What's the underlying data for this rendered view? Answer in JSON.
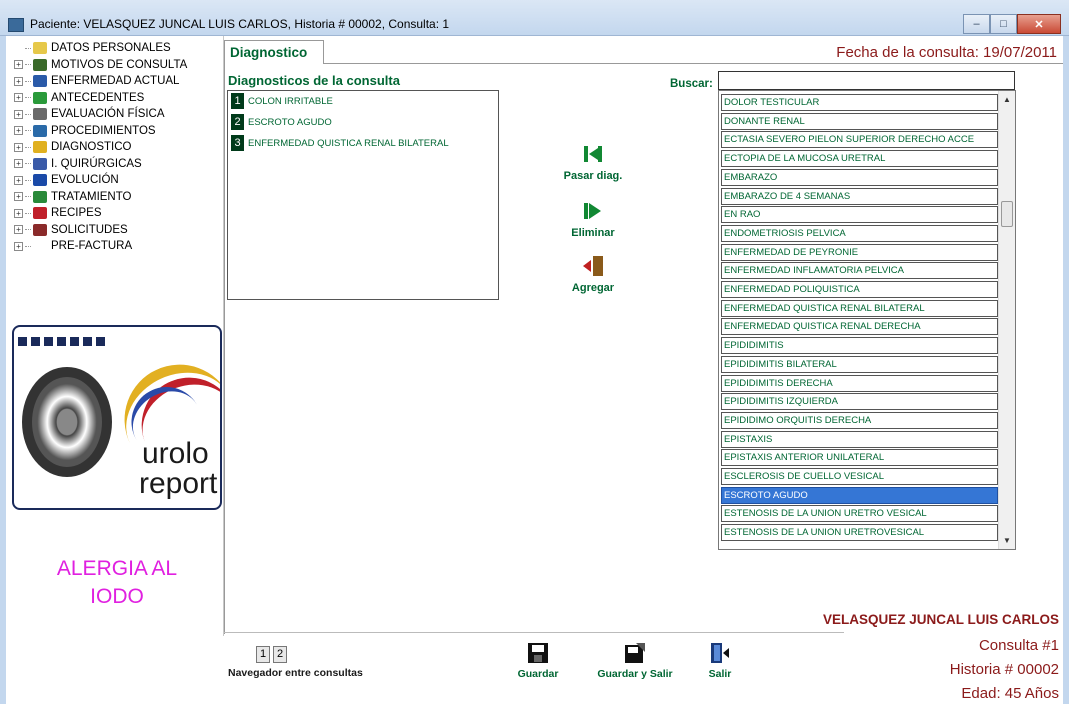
{
  "window": {
    "title": "Paciente: VELASQUEZ JUNCAL LUIS CARLOS, Historia # 00002, Consulta: 1",
    "controls": {
      "minimize": "–",
      "maximize": "□",
      "close": "✕"
    }
  },
  "tree": [
    {
      "label": "DATOS PERSONALES",
      "icon": "folder-open-icon",
      "color": "#e6c84a",
      "expandable": false
    },
    {
      "label": "MOTIVOS DE CONSULTA",
      "icon": "persons-icon",
      "color": "#3a6a2a",
      "expandable": true
    },
    {
      "label": "ENFERMEDAD ACTUAL",
      "icon": "bar-chart-icon",
      "color": "#2a5aa8",
      "expandable": true
    },
    {
      "label": "ANTECEDENTES",
      "icon": "globe-icon",
      "color": "#2a9a3a",
      "expandable": true
    },
    {
      "label": "EVALUACIÓN FÍSICA",
      "icon": "scale-icon",
      "color": "#6a6a6a",
      "expandable": true
    },
    {
      "label": "PROCEDIMIENTOS",
      "icon": "monitor-icon",
      "color": "#2a6aa8",
      "expandable": true
    },
    {
      "label": "DIAGNOSTICO",
      "icon": "lightning-icon",
      "color": "#e0b020",
      "expandable": true
    },
    {
      "label": "I. QUIRÚRGICAS",
      "icon": "grid-icon",
      "color": "#3a5aa8",
      "expandable": true
    },
    {
      "label": "EVOLUCIÓN",
      "icon": "info-icon",
      "color": "#1a4aa8",
      "expandable": true
    },
    {
      "label": "TRATAMIENTO",
      "icon": "plant-icon",
      "color": "#2a8a3a",
      "expandable": true
    },
    {
      "label": "RECIPES",
      "icon": "apple-icon",
      "color": "#c0202a",
      "expandable": true
    },
    {
      "label": "SOLICITUDES",
      "icon": "database-icon",
      "color": "#8a2a2a",
      "expandable": true
    },
    {
      "label": "PRE-FACTURA",
      "icon": "",
      "color": "#ffffff",
      "expandable": true
    }
  ],
  "logo": {
    "line1": "urolo",
    "line2": "report"
  },
  "allergy": {
    "line1": "ALERGIA AL",
    "line2": "IODO"
  },
  "tab": {
    "label": "Diagnostico"
  },
  "fecha": "Fecha de la consulta:  19/07/2011",
  "diagnostics": {
    "title": "Diagnosticos de la consulta",
    "items": [
      {
        "num": "1",
        "text": "COLON IRRITABLE"
      },
      {
        "num": "2",
        "text": "ESCROTO AGUDO"
      },
      {
        "num": "3",
        "text": "ENFERMEDAD QUISTICA RENAL BILATERAL"
      }
    ]
  },
  "actions": {
    "pasar": "Pasar diag.",
    "eliminar": "Eliminar",
    "agregar": "Agregar"
  },
  "search": {
    "label": "Buscar:",
    "value": ""
  },
  "list": {
    "selected_index": 21,
    "items": [
      "DOLOR TESTICULAR",
      "DONANTE  RENAL",
      "ECTASIA SEVERO  PIELON SUPERIOR DERECHO ACCE",
      "ECTOPIA DE LA MUCOSA URETRAL",
      "EMBARAZO",
      "EMBARAZO DE 4 SEMANAS",
      "EN RAO",
      "ENDOMETRIOSIS PELVICA",
      "ENFERMEDAD DE PEYRONIE",
      "ENFERMEDAD INFLAMATORIA PELVICA",
      "ENFERMEDAD POLIQUISTICA",
      "ENFERMEDAD QUISTICA RENAL BILATERAL",
      "ENFERMEDAD QUISTICA RENAL DERECHA",
      "EPIDIDIMITIS",
      "EPIDIDIMITIS BILATERAL",
      "EPIDIDIMITIS DERECHA",
      "EPIDIDIMITIS IZQUIERDA",
      "EPIDIDIMO ORQUITIS DERECHA",
      "EPISTAXIS",
      "EPISTAXIS ANTERIOR UNILATERAL",
      "ESCLEROSIS DE CUELLO VESICAL",
      "ESCROTO AGUDO",
      "ESTENOSIS DE LA UNION URETRO VESICAL",
      "ESTENOSIS DE LA UNION URETROVESICAL"
    ]
  },
  "footer": {
    "nav_label": "Navegador entre consultas",
    "nav_pages": [
      "1",
      "2"
    ],
    "guardar": "Guardar",
    "guardar_salir": "Guardar y Salir",
    "salir": "Salir",
    "patient": "VELASQUEZ JUNCAL LUIS CARLOS",
    "consulta": "Consulta #1",
    "historia": "Historia # 00002",
    "edad": "Edad: 45 Años"
  }
}
